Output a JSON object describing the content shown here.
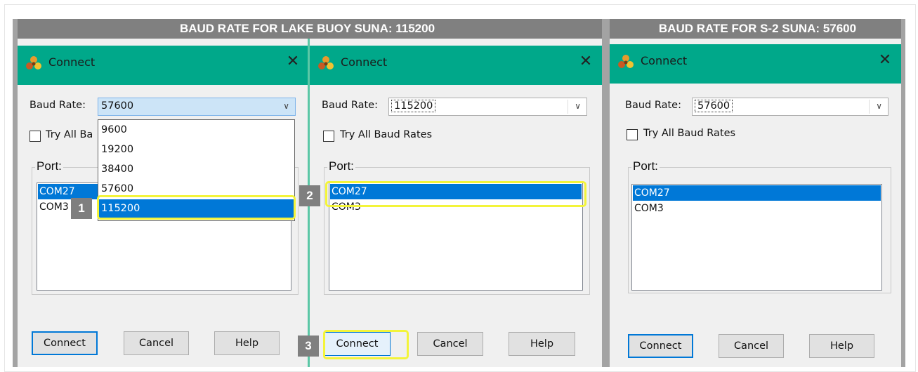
{
  "headers": {
    "left": "BAUD RATE FOR LAKE BUOY SUNA: 115200",
    "right": "BAUD RATE FOR S-2 SUNA: 57600"
  },
  "dialogs": [
    {
      "title": "Connect",
      "baud_label": "Baud Rate:",
      "baud_value": "57600",
      "try_all_label": "Try All Baud Rates",
      "try_all_visible": "Try All Ba",
      "port_label": "Port:",
      "ports": [
        "COM27",
        "COM3"
      ],
      "selected_port": "COM27",
      "buttons": {
        "connect": "Connect",
        "cancel": "Cancel",
        "help": "Help"
      },
      "dropdown_open": true,
      "dropdown_options": [
        "9600",
        "19200",
        "38400",
        "57600",
        "115200"
      ],
      "dropdown_highlight": "115200"
    },
    {
      "title": "Connect",
      "baud_label": "Baud Rate:",
      "baud_value": "115200",
      "try_all_label": "Try All Baud Rates",
      "port_label": "Port:",
      "ports": [
        "COM27",
        "COM3"
      ],
      "selected_port": "COM27",
      "buttons": {
        "connect": "Connect",
        "cancel": "Cancel",
        "help": "Help"
      }
    },
    {
      "title": "Connect",
      "baud_label": "Baud Rate:",
      "baud_value": "57600",
      "try_all_label": "Try All Baud Rates",
      "port_label": "Port:",
      "ports": [
        "COM27",
        "COM3"
      ],
      "selected_port": "COM27",
      "buttons": {
        "connect": "Connect",
        "cancel": "Cancel",
        "help": "Help"
      }
    }
  ],
  "steps": [
    "1",
    "2",
    "3"
  ],
  "colors": {
    "titlebar": "#00a88a",
    "selection": "#0078d7",
    "highlight": "#f3f43a",
    "header": "#808080"
  },
  "icons": {
    "app": "satellite-app-icon",
    "close": "close-icon",
    "dropdown": "chevron-down-icon"
  }
}
